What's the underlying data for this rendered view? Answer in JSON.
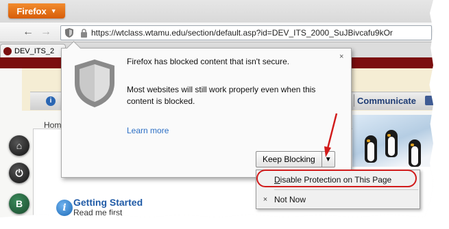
{
  "browser": {
    "menu_button": "Firefox",
    "url": "https://wtclass.wtamu.edu/section/default.asp?id=DEV_ITS_2000_SuJBivcafu9kOr",
    "tab_title": "DEV_ITS_2"
  },
  "page": {
    "menu_item_communicate": "Communicate",
    "menu_item_first": "i",
    "breadcrumb_home": "Hom",
    "getting_started_title": "Getting Started",
    "getting_started_subtitle": "Read me first",
    "side_icon_home": "⌂",
    "side_icon_power": "⏻",
    "side_icon_abc": "B"
  },
  "popup": {
    "title": "Firefox has blocked content that isn't secure.",
    "body": "Most websites will still work properly even when this content is blocked.",
    "learn_more": "Learn more",
    "close": "×",
    "keep_blocking": "Keep Blocking",
    "dropdown_arrow": "▼"
  },
  "dropdown": {
    "disable_protection": "Disable Protection on This Page",
    "not_now": "Not Now",
    "not_now_mark": "×"
  },
  "colors": {
    "highlight": "#d11b1b",
    "firefox_orange": "#e8761b",
    "link_blue": "#2b6ec4"
  }
}
